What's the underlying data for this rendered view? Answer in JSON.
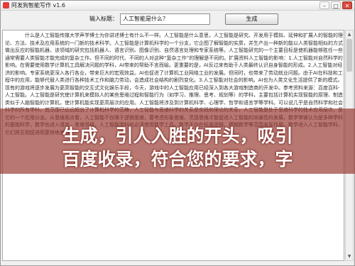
{
  "window": {
    "title": "阿发狗智能写作 v1.6",
    "minimize_glyph": "–",
    "maximize_glyph": "□",
    "close_glyph": "✕"
  },
  "toolbar": {
    "input_label": "输入标题：",
    "input_value": "人工智能是什么？",
    "generate_label": "生成"
  },
  "content": {
    "body_text": "什么是人工智能传媒大学声学博士为你讲述博士有什么不一样。人工智能是什么意思，人工智能是研究、开发用于模拟、延伸和扩展人的智能的理论、方法、技术及应用系统的一门新的技术科学。人工智能是计算机科学的一个分支，它企图了解智能的实质，并生产出一种新的能以人类智能相似的方式做出反应的智能机器，该领域的研究包括机器人、语言识别、图像识别、自然语言处理和专家系统等。人工智能研究的一个主要目标是使机器能够胜任一些通常需要人类智能才能完成的复杂工作。但不同的时代、不同的人对这种“复杂工作”的理解是不同的。扩展资料人工智能的影响：1.人工智能对自然科学的影响。在需要使用数学计算机工具解决问题的学科，AI带来的帮助不言而喻。更重要的是，AI反过来有助于人类最终认识自身智能的形成。2.人工智能对经济的影响。专家系统更深入各行各业，带来巨大的宏观效益。AI也促进了计算机工业网络工业的发展。但同时，也带来了劳动就业问题。由于AI在科技和工程中的应用，能够代替人类进行各种技术工作和脑力劳动，会造成社会结构的剧烈变化。3.人工智能对社会的影响。AI也为人类文化生活提供了新的模式。现有的游戏将逐步发展为更高智能的交互式文化娱乐手段，今天，游戏中的人工智能应用已经深入到各大游戏制造商的开发中。参考资料来源：百度百科-人工智能。人工智能是研究使计算机来模拟人的某些思维过程和智能行为（如学习、推理、思考、规划等）的学科，主要包括计算机实现智能的原理、制造类似于人脑智能的计算机，使计算机能实现更高层次的应用。人工智能将涉及到计算机科学、心理学、哲学和语言学等学科。可以说几乎是自然科学和社会科学的所有学科，其范围已远远超出了计算机科学的范畴，人工智能与思维科学的关系是实践和理论的关系，人工智能是处于思维科学的技术应用层次，是它的一个应用分支。从思维观点看，人工智能不仅限于逻辑思维，要考虑形象思维、灵感思维才能促进人工智能的突破性的发展，数学常被认为是多种学科的基础科学，数学也进入语言、思维领域，人工智能学科也必须借用数学工具，数学不仅在标准逻辑、模糊数学等范围发挥作用，数学进入人工智能学科，它们将互相促进而更快地发展。"
  },
  "overlay": {
    "line1": "生成，引人入胜的开头，吸引",
    "line2": "百度收录，符合您的要求，字"
  },
  "scrollbar": {
    "up_glyph": "▲",
    "down_glyph": "▼"
  }
}
